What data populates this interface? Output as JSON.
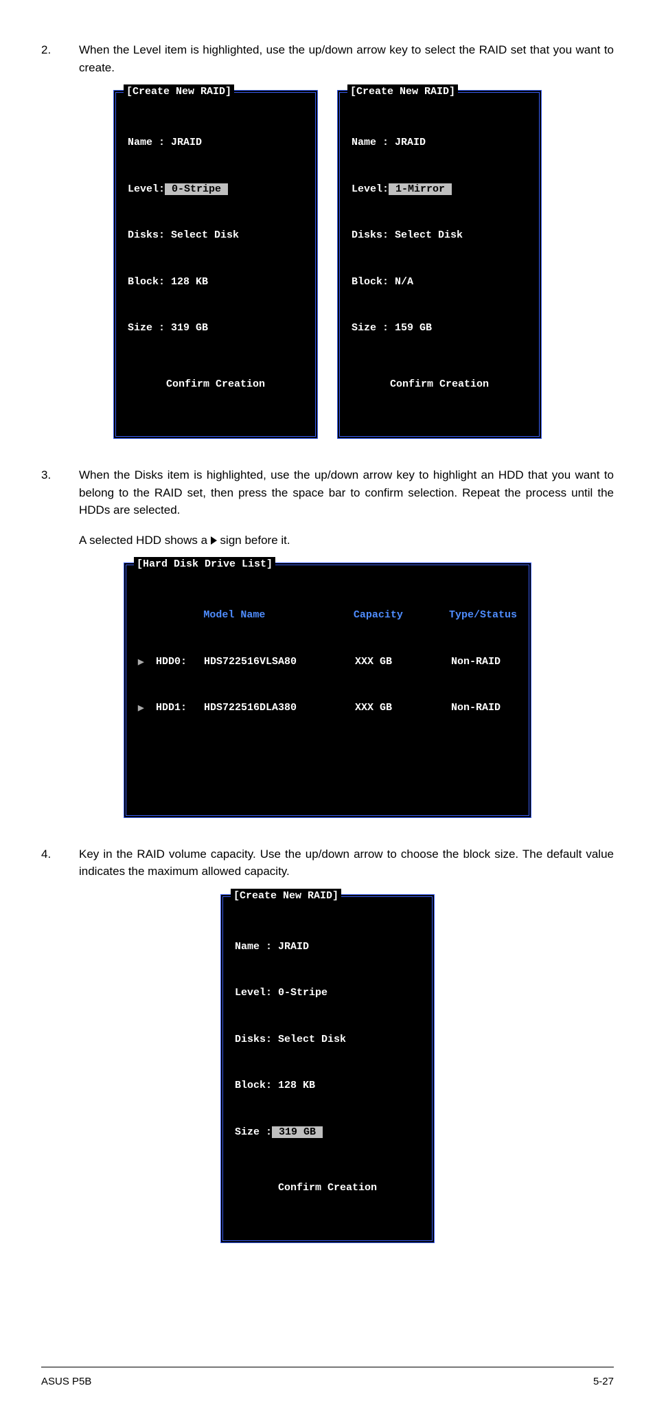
{
  "steps": {
    "s2": {
      "num": "2.",
      "text": "When the Level item is highlighted, use the up/down arrow key to select the RAID set that you want to create."
    },
    "s3": {
      "num": "3.",
      "text": "When the Disks item is highlighted, use the up/down arrow key to highlight an HDD that you want to belong to the RAID set, then press the space bar to confirm selection. Repeat the process until the HDDs are selected."
    },
    "s3b": {
      "prefix": "A selected HDD shows a ",
      "suffix": " sign before it."
    },
    "s4": {
      "num": "4.",
      "text": "Key in the RAID volume capacity. Use the up/down arrow to choose the block size. The default value indicates the maximum allowed capacity."
    }
  },
  "panel1": {
    "title": "[Create New RAID]",
    "rows": {
      "name": "Name : JRAID",
      "level_lbl": "Level:",
      "level_val": " 0-Stripe ",
      "disks": "Disks: Select Disk",
      "block": "Block: 128 KB",
      "size": "Size : 319 GB"
    },
    "confirm": "Confirm Creation"
  },
  "panel2": {
    "title": "[Create New RAID]",
    "rows": {
      "name": "Name : JRAID",
      "level_lbl": "Level:",
      "level_val": " 1-Mirror ",
      "disks": "Disks: Select Disk",
      "block": "Block: N/A",
      "size": "Size : 159 GB"
    },
    "confirm": "Confirm Creation"
  },
  "disklist": {
    "title": "[Hard Disk Drive List]",
    "headers": {
      "model": "Model Name",
      "cap": "Capacity",
      "type": "Type/Status"
    },
    "rows": [
      {
        "id": "HDD0:",
        "model": "HDS722516VLSA80",
        "cap": "XXX GB",
        "type": "Non-RAID"
      },
      {
        "id": "HDD1:",
        "model": "HDS722516DLA380",
        "cap": "XXX GB",
        "type": "Non-RAID"
      }
    ]
  },
  "panel3": {
    "title": "[Create New RAID]",
    "rows": {
      "name": "Name : JRAID",
      "level": "Level: 0-Stripe",
      "disks": "Disks: Select Disk",
      "block": "Block: 128 KB",
      "size_lbl": "Size :",
      "size_val": " 319 GB "
    },
    "confirm": "Confirm Creation"
  },
  "footer": {
    "left": "ASUS P5B",
    "right": "5-27"
  }
}
